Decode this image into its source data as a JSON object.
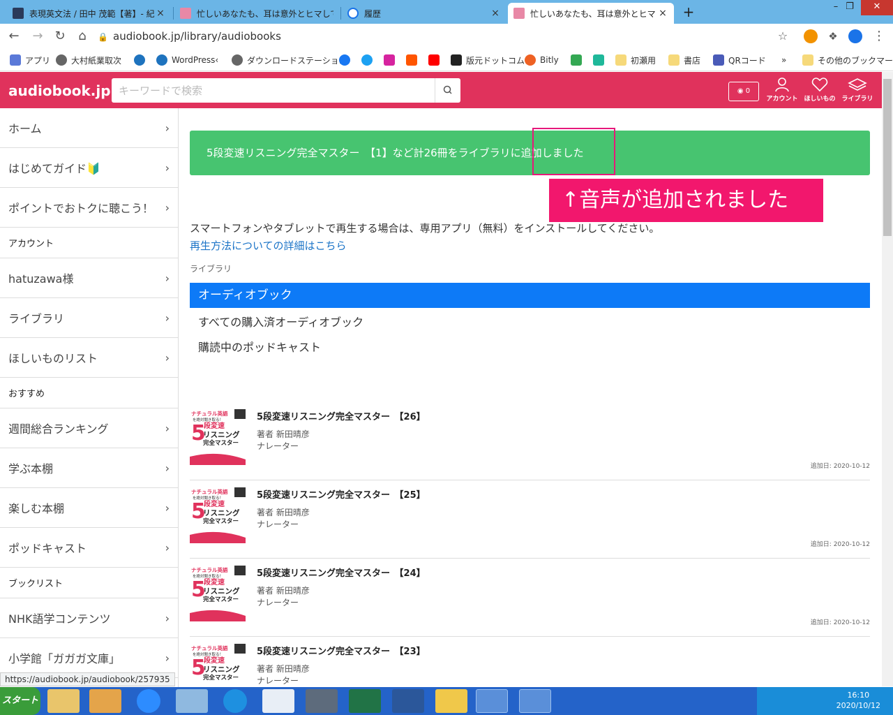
{
  "browser": {
    "tabs": [
      {
        "title": "表現英文法 / 田中 茂範【著】- 紀",
        "close": "×"
      },
      {
        "title": "忙しいあなたも、耳は意外とヒマしてる",
        "close": ""
      },
      {
        "title": "履歴",
        "close": "×"
      },
      {
        "title": "忙しいあなたも、耳は意外とヒマしてる",
        "close": "×"
      }
    ],
    "new_tab": "+",
    "url": "audiobook.jp/library/audiobooks",
    "bookmarks": [
      "アプリ",
      "大村紙業取次",
      "WordPress‹",
      "ダウンロードステーショ…",
      "版元ドットコム",
      "Bitly",
      "初瀬用",
      "書店",
      "QRコード",
      "»",
      "その他のブックマーク"
    ]
  },
  "site": {
    "logo": "audiobook.jp",
    "search_placeholder": "キーワードで検索",
    "points": "0",
    "header_icons": {
      "account": "アカウント",
      "wishlist": "ほしいもの",
      "library": "ライブラリ"
    }
  },
  "sidebar": {
    "items": [
      {
        "label": "ホーム",
        "type": "link"
      },
      {
        "label": "はじめてガイド🔰",
        "type": "link"
      },
      {
        "label": "ポイントでおトクに聴こう！",
        "type": "link"
      },
      {
        "label": "アカウント",
        "type": "heading"
      },
      {
        "label": "hatuzawa様",
        "type": "link"
      },
      {
        "label": "ライブラリ",
        "type": "link"
      },
      {
        "label": "ほしいものリスト",
        "type": "link"
      },
      {
        "label": "おすすめ",
        "type": "heading"
      },
      {
        "label": "週間総合ランキング",
        "type": "link"
      },
      {
        "label": "学ぶ本棚",
        "type": "link"
      },
      {
        "label": "楽しむ本棚",
        "type": "link"
      },
      {
        "label": "ポッドキャスト",
        "type": "link"
      },
      {
        "label": "ブックリスト",
        "type": "heading"
      },
      {
        "label": "NHK語学コンテンツ",
        "type": "link"
      },
      {
        "label": "小学館「ガガガ文庫」",
        "type": "link"
      }
    ]
  },
  "main": {
    "banner": "5段変速リスニング完全マスター　【1】など計26冊をライブラリに追加しました",
    "callout": "↑音声が追加されました",
    "intro": "スマートフォンやタブレットで再生する場合は、専用アプリ（無料）をインストールしてください。",
    "howto_link": "再生方法についての詳細はこちら",
    "library_label": "ライブラリ",
    "active_tab": "オーディオブック",
    "subtabs": [
      "すべての購入済オーディオブック",
      "購読中のポッドキャスト"
    ],
    "books": [
      {
        "title": "5段変速リスニング完全マスター　【26】",
        "author": "著者 新田晴彦",
        "narrator": "ナレーター",
        "date": "追加日: 2020-10-12"
      },
      {
        "title": "5段変速リスニング完全マスター　【25】",
        "author": "著者 新田晴彦",
        "narrator": "ナレーター",
        "date": "追加日: 2020-10-12"
      },
      {
        "title": "5段変速リスニング完全マスター　【24】",
        "author": "著者 新田晴彦",
        "narrator": "ナレーター",
        "date": "追加日: 2020-10-12"
      },
      {
        "title": "5段変速リスニング完全マスター　【23】",
        "author": "著者 新田晴彦",
        "narrator": "ナレーター",
        "date": ""
      }
    ],
    "cover_text": {
      "line1": "ナチュラル英語",
      "line2": "を絶対聞き取る！",
      "digit": "5",
      "line3": "段変速",
      "line4": "リスニング",
      "line5": "完全マスター"
    }
  },
  "status_url": "https://audiobook.jp/audiobook/257935",
  "taskbar": {
    "start": "スタート",
    "time": "16:10",
    "date": "2020/10/12"
  },
  "colors": {
    "brand": "#e0325c",
    "success": "#47c470",
    "active_tab": "#0d7af7",
    "callout": "#f2176d"
  }
}
